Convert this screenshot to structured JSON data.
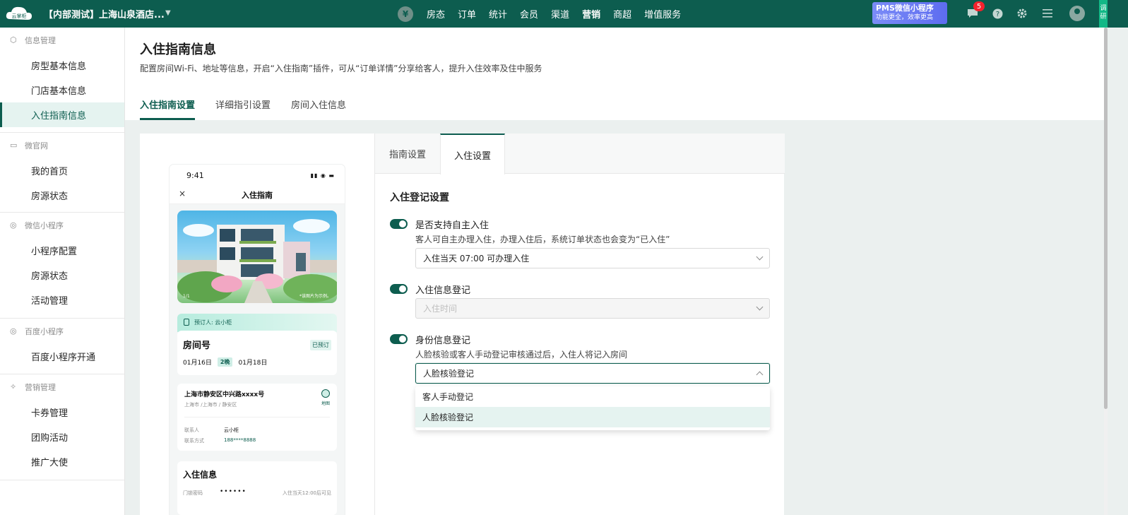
{
  "topbar": {
    "logo_text": "云掌柜",
    "store_name": "【内部测试】上海山泉酒店...",
    "nav_yen": "¥",
    "nav_items": [
      "房态",
      "订单",
      "统计",
      "会员",
      "渠道",
      "营销",
      "商超",
      "增值服务"
    ],
    "active_nav": "营销",
    "promo_title": "PMS微信小程序",
    "promo_sub": "功能更全，效率更高",
    "badge_count": "5",
    "right_tab": "调研"
  },
  "sidebar": {
    "groups": [
      {
        "title": "信息管理",
        "icon": "cube-icon",
        "items": [
          "房型基本信息",
          "门店基本信息",
          "入住指南信息"
        ]
      },
      {
        "title": "微官网",
        "icon": "monitor-icon",
        "items": [
          "我的首页",
          "房源状态"
        ]
      },
      {
        "title": "微信小程序",
        "icon": "compass-icon",
        "items": [
          "小程序配置",
          "房源状态",
          "活动管理"
        ]
      },
      {
        "title": "百度小程序",
        "icon": "compass-icon",
        "items": [
          "百度小程序开通"
        ]
      },
      {
        "title": "营销管理",
        "icon": "marketing-icon",
        "items": [
          "卡券管理",
          "团购活动",
          "推广大使"
        ]
      }
    ],
    "active_item": "入住指南信息"
  },
  "header": {
    "title": "入住指南信息",
    "description": "配置房间Wi-Fi、地址等信息，开启“入住指南”插件，可从“订单详情”分享给客人，提升入住效率及住中服务",
    "tabs": [
      "入住指南设置",
      "详细指引设置",
      "房间入住信息"
    ],
    "active_tab": "入住指南设置"
  },
  "phone": {
    "time": "9:41",
    "title": "入住指南",
    "close": "×",
    "hero_caption": "*该图片为示例。",
    "hero_index": "1/1",
    "booker": "预订人: 云小柜",
    "room_title": "房间号",
    "room_status": "已预订",
    "date_in": "01月16日",
    "nights": "2晚",
    "date_out": "01月18日",
    "address": "上海市静安区中兴路xxxx号",
    "address_sub": "上海市 /上海市 / 静安区",
    "map_label": "地图",
    "contact_label": "联系人",
    "contact_value": "云小柜",
    "phone_label": "联系方式",
    "phone_value": "188****8888",
    "checkin_title": "入住信息",
    "lock_label": "门锁密码",
    "lock_value": "••••••",
    "lock_note": "入住当天12:00后可见"
  },
  "settings": {
    "tabs": [
      "指南设置",
      "入住设置"
    ],
    "active_tab": "入住设置",
    "section_title": "入住登记设置",
    "options": [
      {
        "label": "是否支持自主入住",
        "desc": "客人可自主办理入住，办理入住后，系统订单状态也会变为“已入住”",
        "select_value": "入住当天 07:00 可办理入住",
        "enabled": true
      },
      {
        "label": "入住信息登记",
        "desc": "",
        "select_placeholder": "入住时间",
        "enabled": true
      },
      {
        "label": "身份信息登记",
        "desc": "人脸核验或客人手动登记审核通过后，入住人将记入房间",
        "select_value": "人脸核验登记",
        "enabled": true
      }
    ],
    "dropdown_options": [
      "客人手动登记",
      "人脸核验登记"
    ],
    "dropdown_selected": "人脸核验登记"
  },
  "colors": {
    "brand": "#0d5d4f",
    "accent_light": "#e5f3f0",
    "badge": "#f5222d",
    "promo": "#6f7ef4"
  }
}
